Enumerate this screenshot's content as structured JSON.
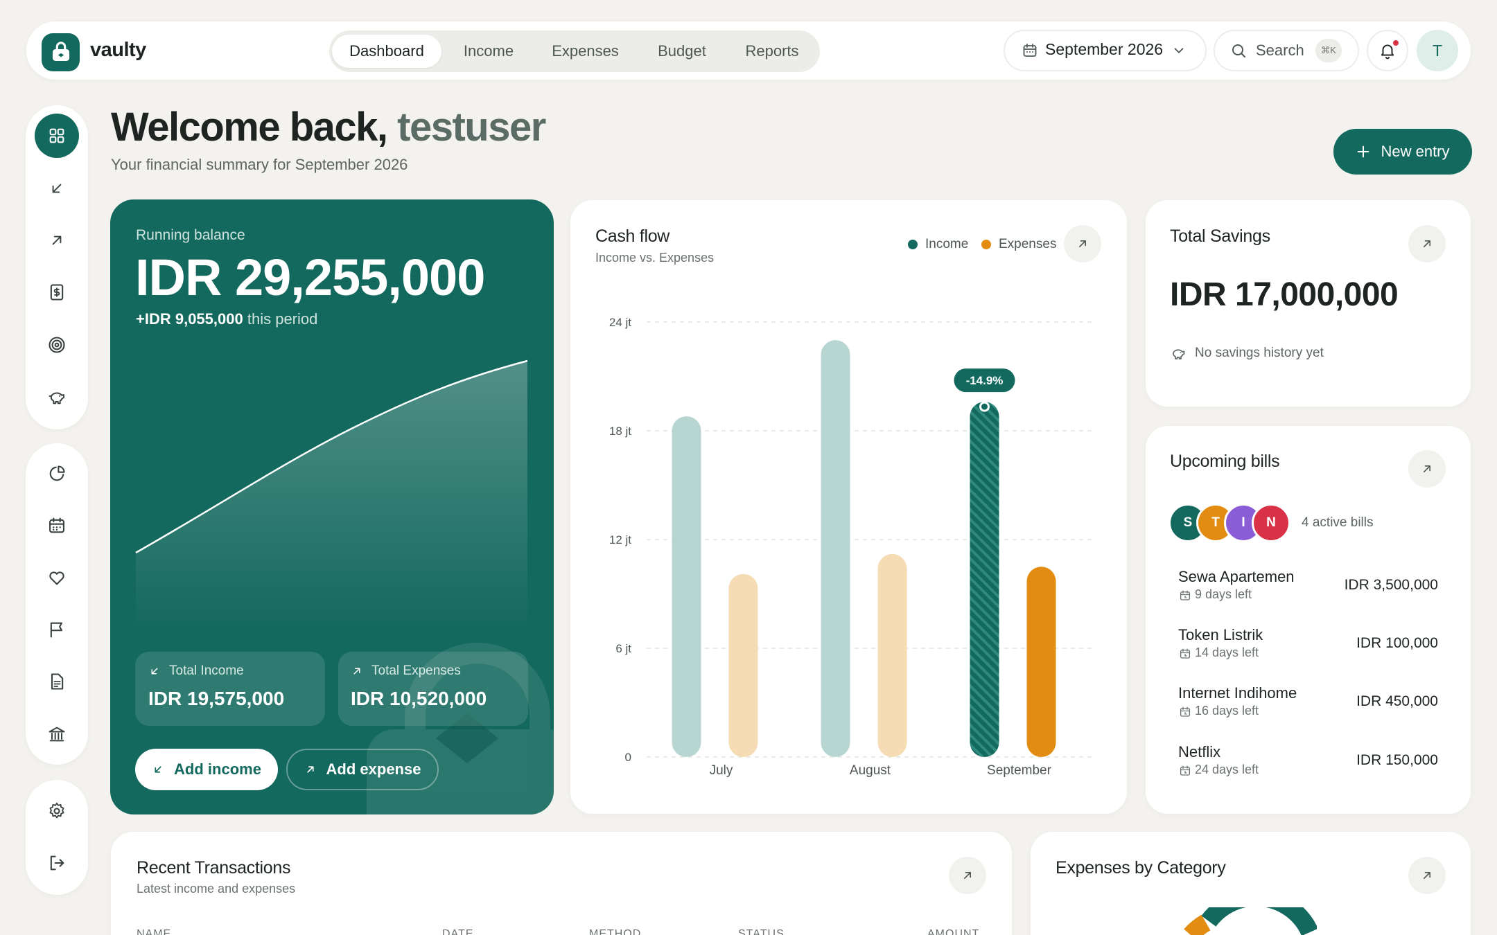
{
  "brand": {
    "name": "vaulty"
  },
  "nav": {
    "tabs": [
      {
        "label": "Dashboard",
        "active": true
      },
      {
        "label": "Income"
      },
      {
        "label": "Expenses"
      },
      {
        "label": "Budget"
      },
      {
        "label": "Reports"
      }
    ]
  },
  "topbar": {
    "period": "September 2026",
    "search_label": "Search",
    "search_shortcut": "⌘K",
    "avatar_initial": "T",
    "has_notification": true
  },
  "sidebar": {
    "group1": [
      "dashboard-icon",
      "income-icon",
      "expense-icon",
      "budget-icon",
      "goals-icon",
      "savings-icon"
    ],
    "group2": [
      "reports-icon",
      "calendar-icon",
      "wishlist-icon",
      "flag-icon",
      "document-icon",
      "bank-icon"
    ],
    "group3": [
      "settings-icon",
      "logout-icon"
    ]
  },
  "header": {
    "welcome": "Welcome back,",
    "username": "testuser",
    "subtitle": "Your financial summary for September 2026",
    "new_entry_label": "New entry"
  },
  "balance": {
    "label": "Running balance",
    "value": "IDR 29,255,000",
    "delta_amount": "+IDR 9,055,000",
    "delta_suffix": "this period",
    "total_income_label": "Total Income",
    "total_income_value": "IDR 19,575,000",
    "total_expenses_label": "Total Expenses",
    "total_expenses_value": "IDR 10,520,000",
    "add_income_label": "Add income",
    "add_expense_label": "Add expense"
  },
  "cashflow": {
    "title": "Cash flow",
    "subtitle": "Income vs. Expenses",
    "badge": "-14.9%"
  },
  "chart_data": {
    "type": "bar",
    "categories": [
      "July",
      "August",
      "September"
    ],
    "series": [
      {
        "name": "Income",
        "values": [
          18.8,
          23.0,
          19.6
        ],
        "color": "#14695e"
      },
      {
        "name": "Expenses",
        "values": [
          10.1,
          11.2,
          10.5
        ],
        "color": "#e38c12"
      }
    ],
    "ylim": [
      0,
      24
    ],
    "yticks": [
      "0",
      "6 jt",
      "12 jt",
      "18 jt",
      "24 jt"
    ],
    "highlight_category": "September",
    "legend": "top-right",
    "grid": true
  },
  "savings": {
    "title": "Total Savings",
    "value": "IDR 17,000,000",
    "note": "No savings history yet"
  },
  "bills": {
    "title": "Upcoming bills",
    "active_count": "4 active bills",
    "avatars": [
      {
        "initial": "S",
        "color": "#14695e"
      },
      {
        "initial": "T",
        "color": "#e38c12"
      },
      {
        "initial": "I",
        "color": "#8a5cd6"
      },
      {
        "initial": "N",
        "color": "#d93246"
      }
    ],
    "items": [
      {
        "name": "Sewa Apartemen",
        "days": "9 days left",
        "amount": "IDR 3,500,000"
      },
      {
        "name": "Token Listrik",
        "days": "14 days left",
        "amount": "IDR 100,000"
      },
      {
        "name": "Internet Indihome",
        "days": "16 days left",
        "amount": "IDR 450,000"
      },
      {
        "name": "Netflix",
        "days": "24 days left",
        "amount": "IDR 150,000"
      }
    ]
  },
  "transactions": {
    "title": "Recent Transactions",
    "subtitle": "Latest income and expenses",
    "columns": [
      "NAME",
      "DATE",
      "METHOD",
      "STATUS",
      "AMOUNT"
    ]
  },
  "categories": {
    "title": "Expenses by Category"
  }
}
